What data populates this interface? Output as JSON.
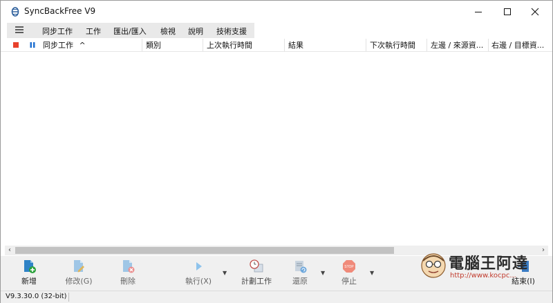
{
  "window": {
    "title": "SyncBackFree V9"
  },
  "menu": {
    "items": [
      "同步工作",
      "工作",
      "匯出/匯入",
      "檢視",
      "說明",
      "技術支援"
    ]
  },
  "columns": [
    {
      "label": "同步工作",
      "sort": "^"
    },
    {
      "label": "類別"
    },
    {
      "label": "上次執行時間"
    },
    {
      "label": "結果"
    },
    {
      "label": "下次執行時間"
    },
    {
      "label": "左邊 / 來源資..."
    },
    {
      "label": "右邊 / 目標資..."
    }
  ],
  "toolbar": {
    "new": "新增",
    "edit": "修改(G)",
    "delete": "刪除",
    "run": "執行(X)",
    "schedule": "計劃工作",
    "restore": "還原",
    "stop": "停止",
    "exit": "結束(I)"
  },
  "watermark": {
    "text": "電腦王阿達",
    "url": "http://www.kocpc..."
  },
  "status": {
    "version": "V9.3.30.0 (32-bit)"
  },
  "colors": {
    "stop_red": "#e8412c",
    "pause_blue": "#1e6fd0",
    "run_blue": "#3a8fdc"
  }
}
